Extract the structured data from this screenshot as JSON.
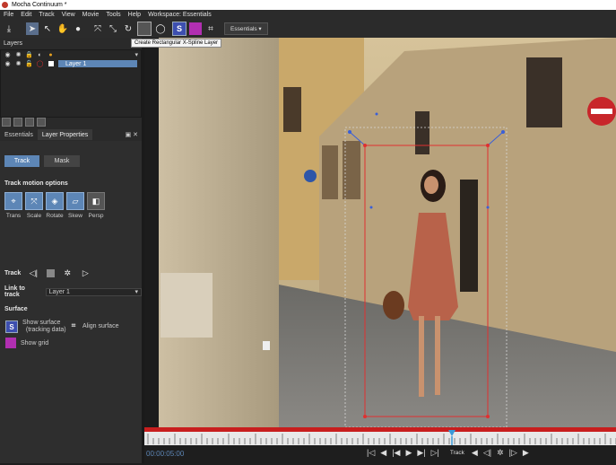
{
  "window": {
    "title": "Mocha Continuum *"
  },
  "menu": [
    "File",
    "Edit",
    "Track",
    "View",
    "Movie",
    "Tools",
    "Help",
    "Workspace: Essentials"
  ],
  "toolbar": {
    "workspace_label": "Essentials",
    "tooltip": "Create Rectangular X-Spline Layer",
    "tools": [
      "export-icon",
      "pointer-icon",
      "add-point-icon",
      "hand-icon",
      "zoom-icon",
      "move-icon",
      "scale-icon",
      "rotate-icon",
      "create-rect-spline-icon",
      "create-circle-spline-icon",
      "surface-icon",
      "grid-icon",
      "transform-icon"
    ]
  },
  "layers": {
    "header": "Layers",
    "items": [
      {
        "name": "Layer 1",
        "color": "#e03030"
      }
    ]
  },
  "panel_tabs": [
    "Essentials",
    "Layer Properties"
  ],
  "essentials": {
    "track_btn": "Track",
    "mask_btn": "Mask",
    "motion_title": "Track motion options",
    "motion_options": [
      {
        "label": "Trans",
        "on": true
      },
      {
        "label": "Scale",
        "on": true
      },
      {
        "label": "Rotate",
        "on": true
      },
      {
        "label": "Skew",
        "on": true
      },
      {
        "label": "Persp",
        "on": false
      }
    ],
    "track_label": "Track",
    "link_label": "Link to track",
    "link_value": "Layer 1",
    "surface_title": "Surface",
    "show_surface": "Show surface",
    "tracking_data": "(tracking data)",
    "align_surface": "Align surface",
    "show_grid": "Show grid"
  },
  "timeline": {
    "timecode": "00:00:05:00",
    "track_label": "Track"
  },
  "colors": {
    "accent": "#5d86b6",
    "spline": "#e03030",
    "timeline_bar": "#c81e1e",
    "playhead": "#3a9ad9"
  }
}
